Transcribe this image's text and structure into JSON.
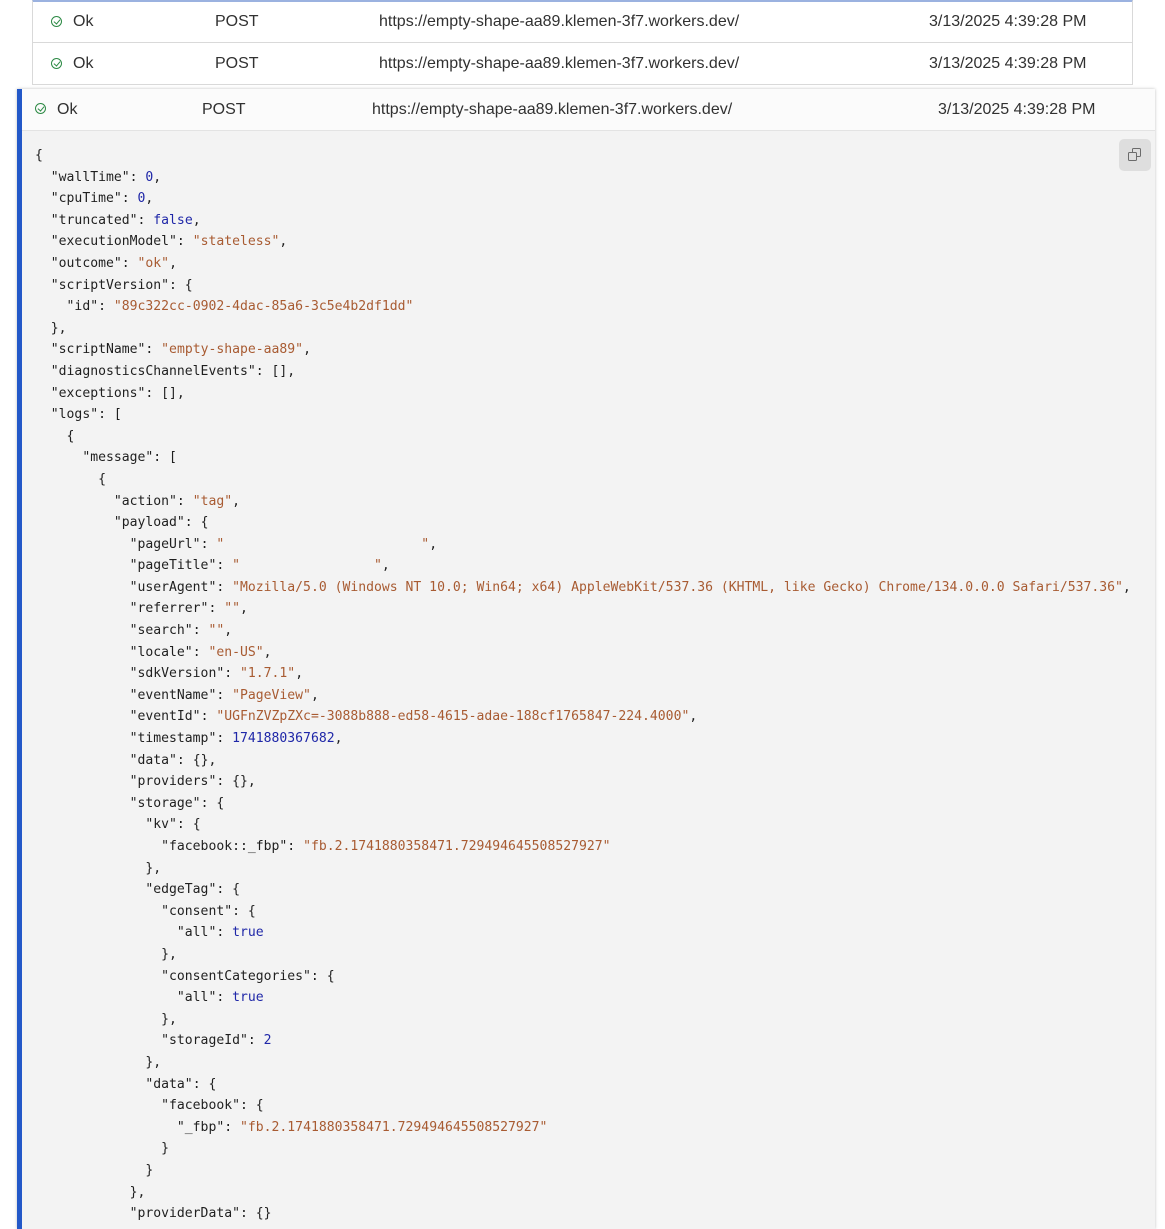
{
  "log_rows": [
    {
      "status": "Ok",
      "method": "POST",
      "url": "https://empty-shape-aa89.klemen-3f7.workers.dev/",
      "time": "3/13/2025 4:39:28 PM"
    },
    {
      "status": "Ok",
      "method": "POST",
      "url": "https://empty-shape-aa89.klemen-3f7.workers.dev/",
      "time": "3/13/2025 4:39:28 PM"
    }
  ],
  "expanded": {
    "status": "Ok",
    "method": "POST",
    "url": "https://empty-shape-aa89.klemen-3f7.workers.dev/",
    "time": "3/13/2025 4:39:28 PM",
    "copy_icon": "copy-icon",
    "colors": {
      "accent": "#2358c8",
      "status_ok": "#2d8a45",
      "json_string": "#a85b32",
      "json_number": "#1f27a8"
    },
    "json_lines": [
      [
        [
          "p",
          "{"
        ]
      ],
      [
        [
          "p",
          "  "
        ],
        [
          "k",
          "\"wallTime\""
        ],
        [
          "p",
          ": "
        ],
        [
          "n",
          "0"
        ],
        [
          "p",
          ","
        ]
      ],
      [
        [
          "p",
          "  "
        ],
        [
          "k",
          "\"cpuTime\""
        ],
        [
          "p",
          ": "
        ],
        [
          "n",
          "0"
        ],
        [
          "p",
          ","
        ]
      ],
      [
        [
          "p",
          "  "
        ],
        [
          "k",
          "\"truncated\""
        ],
        [
          "p",
          ": "
        ],
        [
          "b",
          "false"
        ],
        [
          "p",
          ","
        ]
      ],
      [
        [
          "p",
          "  "
        ],
        [
          "k",
          "\"executionModel\""
        ],
        [
          "p",
          ": "
        ],
        [
          "s",
          "\"stateless\""
        ],
        [
          "p",
          ","
        ]
      ],
      [
        [
          "p",
          "  "
        ],
        [
          "k",
          "\"outcome\""
        ],
        [
          "p",
          ": "
        ],
        [
          "s",
          "\"ok\""
        ],
        [
          "p",
          ","
        ]
      ],
      [
        [
          "p",
          "  "
        ],
        [
          "k",
          "\"scriptVersion\""
        ],
        [
          "p",
          ": {"
        ]
      ],
      [
        [
          "p",
          "    "
        ],
        [
          "k",
          "\"id\""
        ],
        [
          "p",
          ": "
        ],
        [
          "s",
          "\"89c322cc-0902-4dac-85a6-3c5e4b2df1dd\""
        ]
      ],
      [
        [
          "p",
          "  },"
        ]
      ],
      [
        [
          "p",
          "  "
        ],
        [
          "k",
          "\"scriptName\""
        ],
        [
          "p",
          ": "
        ],
        [
          "s",
          "\"empty-shape-aa89\""
        ],
        [
          "p",
          ","
        ]
      ],
      [
        [
          "p",
          "  "
        ],
        [
          "k",
          "\"diagnosticsChannelEvents\""
        ],
        [
          "p",
          ": [],"
        ]
      ],
      [
        [
          "p",
          "  "
        ],
        [
          "k",
          "\"exceptions\""
        ],
        [
          "p",
          ": [],"
        ]
      ],
      [
        [
          "p",
          "  "
        ],
        [
          "k",
          "\"logs\""
        ],
        [
          "p",
          ": ["
        ]
      ],
      [
        [
          "p",
          "    {"
        ]
      ],
      [
        [
          "p",
          "      "
        ],
        [
          "k",
          "\"message\""
        ],
        [
          "p",
          ": ["
        ]
      ],
      [
        [
          "p",
          "        {"
        ]
      ],
      [
        [
          "p",
          "          "
        ],
        [
          "k",
          "\"action\""
        ],
        [
          "p",
          ": "
        ],
        [
          "s",
          "\"tag\""
        ],
        [
          "p",
          ","
        ]
      ],
      [
        [
          "p",
          "          "
        ],
        [
          "k",
          "\"payload\""
        ],
        [
          "p",
          ": {"
        ]
      ],
      [
        [
          "p",
          "            "
        ],
        [
          "k",
          "\"pageUrl\""
        ],
        [
          "p",
          ": "
        ],
        [
          "s",
          "\"                         \""
        ],
        [
          "p",
          ","
        ]
      ],
      [
        [
          "p",
          "            "
        ],
        [
          "k",
          "\"pageTitle\""
        ],
        [
          "p",
          ": "
        ],
        [
          "s",
          "\"                 \""
        ],
        [
          "p",
          ","
        ]
      ],
      [
        [
          "p",
          "            "
        ],
        [
          "k",
          "\"userAgent\""
        ],
        [
          "p",
          ": "
        ],
        [
          "s",
          "\"Mozilla/5.0 (Windows NT 10.0; Win64; x64) AppleWebKit/537.36 (KHTML, like Gecko) Chrome/134.0.0.0 Safari/537.36\""
        ],
        [
          "p",
          ","
        ]
      ],
      [
        [
          "p",
          "            "
        ],
        [
          "k",
          "\"referrer\""
        ],
        [
          "p",
          ": "
        ],
        [
          "s",
          "\"\""
        ],
        [
          "p",
          ","
        ]
      ],
      [
        [
          "p",
          "            "
        ],
        [
          "k",
          "\"search\""
        ],
        [
          "p",
          ": "
        ],
        [
          "s",
          "\"\""
        ],
        [
          "p",
          ","
        ]
      ],
      [
        [
          "p",
          "            "
        ],
        [
          "k",
          "\"locale\""
        ],
        [
          "p",
          ": "
        ],
        [
          "s",
          "\"en-US\""
        ],
        [
          "p",
          ","
        ]
      ],
      [
        [
          "p",
          "            "
        ],
        [
          "k",
          "\"sdkVersion\""
        ],
        [
          "p",
          ": "
        ],
        [
          "s",
          "\"1.7.1\""
        ],
        [
          "p",
          ","
        ]
      ],
      [
        [
          "p",
          "            "
        ],
        [
          "k",
          "\"eventName\""
        ],
        [
          "p",
          ": "
        ],
        [
          "s",
          "\"PageView\""
        ],
        [
          "p",
          ","
        ]
      ],
      [
        [
          "p",
          "            "
        ],
        [
          "k",
          "\"eventId\""
        ],
        [
          "p",
          ": "
        ],
        [
          "s",
          "\"UGFnZVZpZXc=-3088b888-ed58-4615-adae-188cf1765847-224.4000\""
        ],
        [
          "p",
          ","
        ]
      ],
      [
        [
          "p",
          "            "
        ],
        [
          "k",
          "\"timestamp\""
        ],
        [
          "p",
          ": "
        ],
        [
          "n",
          "1741880367682"
        ],
        [
          "p",
          ","
        ]
      ],
      [
        [
          "p",
          "            "
        ],
        [
          "k",
          "\"data\""
        ],
        [
          "p",
          ": {},"
        ]
      ],
      [
        [
          "p",
          "            "
        ],
        [
          "k",
          "\"providers\""
        ],
        [
          "p",
          ": {},"
        ]
      ],
      [
        [
          "p",
          "            "
        ],
        [
          "k",
          "\"storage\""
        ],
        [
          "p",
          ": {"
        ]
      ],
      [
        [
          "p",
          "              "
        ],
        [
          "k",
          "\"kv\""
        ],
        [
          "p",
          ": {"
        ]
      ],
      [
        [
          "p",
          "                "
        ],
        [
          "k",
          "\"facebook::_fbp\""
        ],
        [
          "p",
          ": "
        ],
        [
          "s",
          "\"fb.2.1741880358471.729494645508527927\""
        ]
      ],
      [
        [
          "p",
          "              },"
        ]
      ],
      [
        [
          "p",
          "              "
        ],
        [
          "k",
          "\"edgeTag\""
        ],
        [
          "p",
          ": {"
        ]
      ],
      [
        [
          "p",
          "                "
        ],
        [
          "k",
          "\"consent\""
        ],
        [
          "p",
          ": {"
        ]
      ],
      [
        [
          "p",
          "                  "
        ],
        [
          "k",
          "\"all\""
        ],
        [
          "p",
          ": "
        ],
        [
          "b",
          "true"
        ]
      ],
      [
        [
          "p",
          "                },"
        ]
      ],
      [
        [
          "p",
          "                "
        ],
        [
          "k",
          "\"consentCategories\""
        ],
        [
          "p",
          ": {"
        ]
      ],
      [
        [
          "p",
          "                  "
        ],
        [
          "k",
          "\"all\""
        ],
        [
          "p",
          ": "
        ],
        [
          "b",
          "true"
        ]
      ],
      [
        [
          "p",
          "                },"
        ]
      ],
      [
        [
          "p",
          "                "
        ],
        [
          "k",
          "\"storageId\""
        ],
        [
          "p",
          ": "
        ],
        [
          "n",
          "2"
        ]
      ],
      [
        [
          "p",
          "              },"
        ]
      ],
      [
        [
          "p",
          "              "
        ],
        [
          "k",
          "\"data\""
        ],
        [
          "p",
          ": {"
        ]
      ],
      [
        [
          "p",
          "                "
        ],
        [
          "k",
          "\"facebook\""
        ],
        [
          "p",
          ": {"
        ]
      ],
      [
        [
          "p",
          "                  "
        ],
        [
          "k",
          "\"_fbp\""
        ],
        [
          "p",
          ": "
        ],
        [
          "s",
          "\"fb.2.1741880358471.729494645508527927\""
        ]
      ],
      [
        [
          "p",
          "                }"
        ]
      ],
      [
        [
          "p",
          "              }"
        ]
      ],
      [
        [
          "p",
          "            },"
        ]
      ],
      [
        [
          "p",
          "            "
        ],
        [
          "k",
          "\"providerData\""
        ],
        [
          "p",
          ": {}"
        ]
      ]
    ]
  }
}
